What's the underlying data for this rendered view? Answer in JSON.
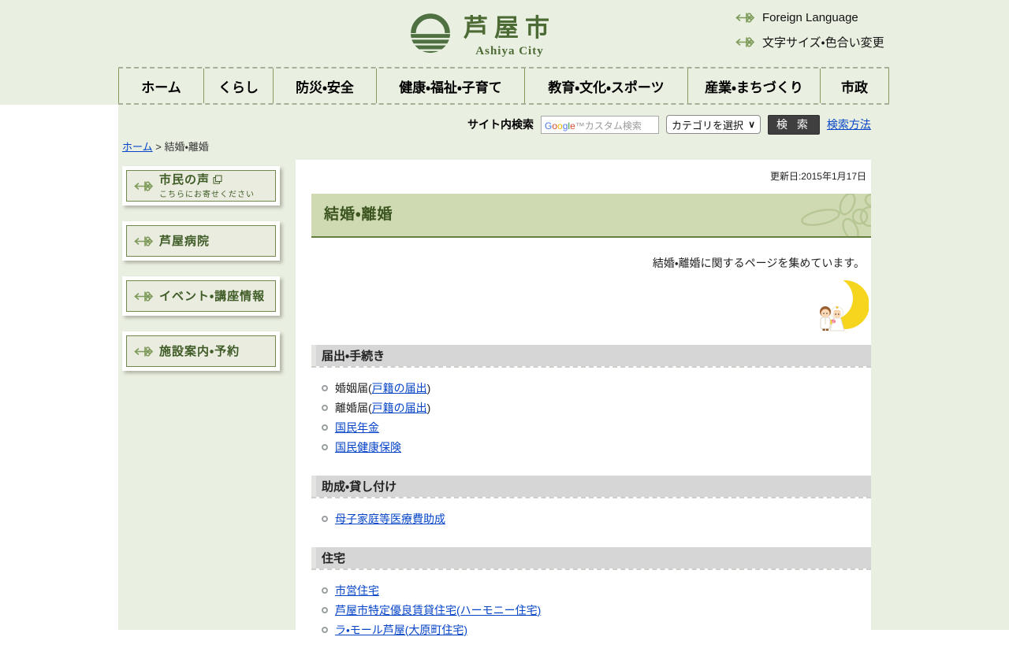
{
  "header": {
    "site_name": "芦屋市",
    "site_name_en": "Ashiya City",
    "links": [
      {
        "label": "Foreign Language"
      },
      {
        "label": "文字サイズ・色合い変更"
      }
    ]
  },
  "nav": {
    "items": [
      {
        "label": "ホーム"
      },
      {
        "label": "くらし"
      },
      {
        "label": "防災・安全"
      },
      {
        "label": "健康・福祉・子育て"
      },
      {
        "label": "教育・文化・スポーツ"
      },
      {
        "label": "産業・まちづくり"
      },
      {
        "label": "市政"
      }
    ]
  },
  "search": {
    "label": "サイト内検索",
    "placeholder": "Google™カスタム検索",
    "google_colors": [
      "#4b7be8",
      "#d6492f",
      "#f0b400",
      "#4b7be8",
      "#3f9b3f",
      "#d6492f"
    ],
    "category_selected": "カテゴリを選択",
    "button_label": "検 索",
    "help_link": "検索方法"
  },
  "breadcrumb": {
    "home": "ホーム",
    "separator": " > ",
    "current": "結婚・離婚"
  },
  "sidebar": {
    "buttons": [
      {
        "label": "市民の声",
        "sub": "こちらにお寄せください"
      },
      {
        "label": "芦屋病院"
      },
      {
        "label": "イベント・講座情報"
      },
      {
        "label": "施設案内・予約"
      }
    ]
  },
  "main": {
    "updated": "更新日:2015年1月17日",
    "page_title": "結婚・離婚",
    "intro": "結婚・離婚に関するページを集めています。",
    "illustration": "wedding-couple-on-crescent-moon",
    "sections": [
      {
        "title": "届出・手続き",
        "items": [
          {
            "pre": "婚姻届(",
            "link": "戸籍の届出",
            "post": ")"
          },
          {
            "pre": "離婚届(",
            "link": "戸籍の届出",
            "post": ")"
          },
          {
            "pre": "",
            "link": "国民年金",
            "post": ""
          },
          {
            "pre": "",
            "link": "国民健康保険",
            "post": ""
          }
        ]
      },
      {
        "title": "助成・貸し付け",
        "items": [
          {
            "pre": "",
            "link": "母子家庭等医療費助成",
            "post": ""
          }
        ]
      },
      {
        "title": "住宅",
        "items": [
          {
            "pre": "",
            "link": "市営住宅",
            "post": ""
          },
          {
            "pre": "",
            "link": "芦屋市特定優良賃貸住宅(ハーモニー住宅)",
            "post": ""
          },
          {
            "pre": "",
            "link": "ラ・モール芦屋(大原町住宅)",
            "post": ""
          }
        ]
      }
    ]
  },
  "colors": {
    "background_green": "#e9efe1",
    "brand_green": "#4c6a33",
    "title_bar_green": "#cfdab3",
    "link_blue": "#0645c8",
    "button_dark": "#3f3f3f",
    "section_bar_gray": "#d6d6d6"
  }
}
